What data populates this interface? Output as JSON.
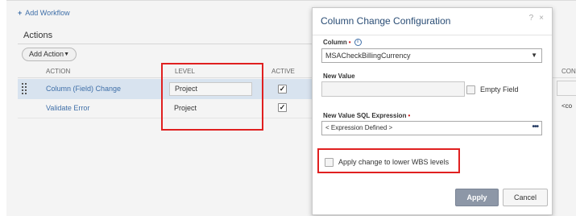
{
  "workflow": {
    "add_workflow_label": "Add Workflow",
    "plus_glyph": "+"
  },
  "actions_section": {
    "title": "Actions",
    "add_action_label": "Add Action",
    "columns": [
      "ACTION",
      "LEVEL",
      "ACTIVE",
      "CON"
    ],
    "rows": [
      {
        "action": "Column (Field) Change",
        "level": "Project",
        "active": true
      },
      {
        "action": "Validate Error",
        "level": "Project",
        "active": true,
        "extra": "<co"
      }
    ]
  },
  "modal": {
    "title": "Column Change Configuration",
    "help_glyph": "?",
    "close_glyph": "×",
    "column_label": "Column",
    "required_mark": "•",
    "column_value": "MSACheckBillingCurrency",
    "new_value_label": "New Value",
    "new_value": "",
    "empty_field_label": "Empty Field",
    "sql_label": "New Value SQL Expression",
    "sql_value": "< Expression Defined >",
    "more_glyph": "•••",
    "apply_lower_label": "Apply change to lower WBS levels",
    "apply_button": "Apply",
    "cancel_button": "Cancel"
  },
  "colors": {
    "link": "#3f6fa8",
    "highlight": "#e02020",
    "selected_row": "#d8e3ef",
    "apply_btn": "#8d97a7"
  }
}
